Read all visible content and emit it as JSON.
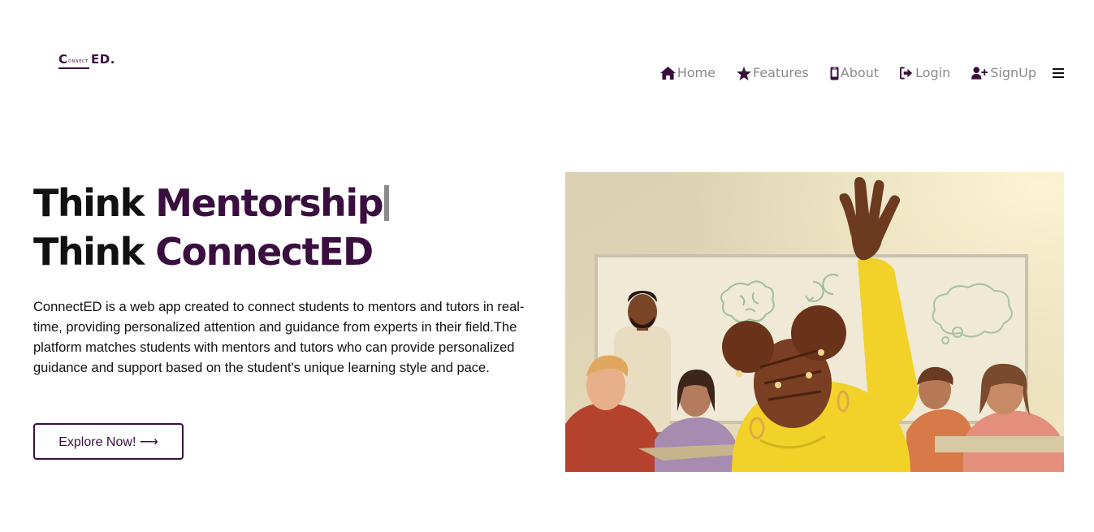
{
  "logo": {
    "letter_c": "C",
    "connect": "ONNECT",
    "ed": "ED."
  },
  "nav": {
    "items": [
      {
        "label": "Home",
        "icon": "home-icon"
      },
      {
        "label": "Features",
        "icon": "star-icon"
      },
      {
        "label": "About",
        "icon": "mobile-icon"
      },
      {
        "label": "Login",
        "icon": "login-icon"
      },
      {
        "label": "SignUp",
        "icon": "user-plus-icon"
      }
    ],
    "menu_icon": "hamburger-icon"
  },
  "hero": {
    "line1_prefix": "Think ",
    "line1_accent": "Mentorship",
    "line2_prefix": "Think ",
    "line2_accent": "ConnectED",
    "description": "ConnectED is a web app created to connect students to mentors and tutors in real-time, providing personalized attention and guidance from experts in their field.The platform matches students with mentors and tutors who can provide personalized guidance and support based on the student's unique learning style and pace.",
    "cta_label": "Explore Now! ⟶"
  },
  "colors": {
    "brand": "#3a0f3f",
    "nav_text": "#8a8a8a",
    "illustration_wall": "#e8dcb6",
    "shirt_yellow": "#f2d229"
  }
}
